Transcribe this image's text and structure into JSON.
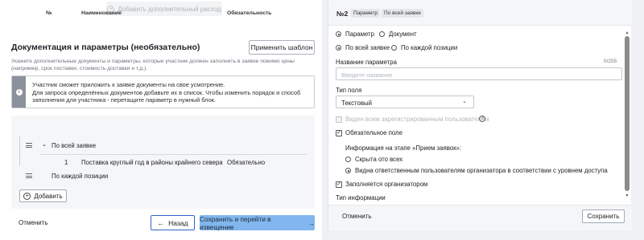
{
  "left_panel": {
    "add_expense_label": "Добавить дополнительный расход",
    "section_title": "Документация и параметры (необязательно)",
    "apply_template_label": "Применить шаблон",
    "section_description": "Укажите дополнительные документы и параметры, которые участник должен заполнить в заявке помимо цены (например, срок поставки, стоимость доставки и т.д.).",
    "info_text": "Участник сможет приложить к заявке документы на свое усмотрение.\nДля запроса определённых документов добавьте их в список. Чтобы изменить порядок и способ заполнения для участника - перетащите параметр в нужный блок.",
    "table": {
      "headers": [
        "№",
        "Наименование",
        "Обязательность"
      ],
      "groups": [
        {
          "label": "По всей заявке",
          "rows": [
            {
              "num": "1",
              "name": "Поставка круглый год в районы крайнего севера",
              "required": "Обязательно"
            }
          ]
        },
        {
          "label": "По каждой позиции",
          "rows": []
        }
      ],
      "add_label": "Добавить"
    },
    "footer": {
      "cancel_label": "Отменить",
      "back_label": "Назад",
      "save_next_label": "Сохранить и перейти в извещение"
    }
  },
  "right_panel": {
    "number": "№2",
    "tags": [
      "Параметр",
      "По всей заявке"
    ],
    "kind_options": [
      {
        "label": "Параметр",
        "selected": true
      },
      {
        "label": "Документ",
        "selected": false
      }
    ],
    "scope_options": [
      {
        "label": "По всей заявке",
        "selected": true
      },
      {
        "label": "По каждой позиции",
        "selected": false
      }
    ],
    "name_label": "Название параметра",
    "name_counter": "0/255",
    "name_placeholder": "Введите название",
    "field_type_label": "Тип поля",
    "field_type_value": "Текстовый",
    "visible_all_label": "Виден всем зарегистрированным пользователям",
    "required_label": "Обязательное поле",
    "required_checked": true,
    "reception_info_label": "Информация на этапе «Прием заявок»:",
    "reception_options": [
      {
        "label": "Скрыта ото всех",
        "selected": false
      },
      {
        "label": "Видна ответственным пользователям организатора в соответствии с уровнем доступа",
        "selected": true
      }
    ],
    "filled_by_org_label": "Заполняется организатором",
    "filled_by_org_checked": true,
    "info_type_label": "Тип информации",
    "cancel_label": "Отменить",
    "save_label": "Сохранить"
  },
  "colors": {
    "primary_button": "#82b6ee",
    "back_border": "#2f66c5",
    "info_stripe": "#8b929b",
    "page_bg": "#eef0f3"
  }
}
